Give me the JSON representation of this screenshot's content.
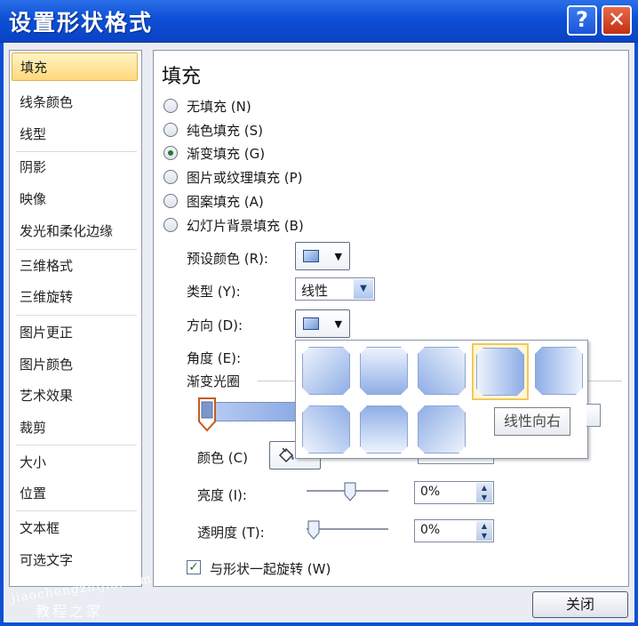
{
  "window": {
    "title": "设置形状格式",
    "help": "?",
    "close": "✕"
  },
  "sidebar": {
    "items": [
      {
        "label": "填充"
      },
      {
        "label": "线条颜色"
      },
      {
        "label": "线型"
      },
      {
        "label": "阴影"
      },
      {
        "label": "映像"
      },
      {
        "label": "发光和柔化边缘"
      },
      {
        "label": "三维格式"
      },
      {
        "label": "三维旋转"
      },
      {
        "label": "图片更正"
      },
      {
        "label": "图片颜色"
      },
      {
        "label": "艺术效果"
      },
      {
        "label": "裁剪"
      },
      {
        "label": "大小"
      },
      {
        "label": "位置"
      },
      {
        "label": "文本框"
      },
      {
        "label": "可选文字"
      }
    ],
    "selected": "填充"
  },
  "panel": {
    "title": "填充",
    "fill_options": [
      {
        "label": "无填充 (N)",
        "checked": false
      },
      {
        "label": "纯色填充 (S)",
        "checked": false
      },
      {
        "label": "渐变填充 (G)",
        "checked": true
      },
      {
        "label": "图片或纹理填充 (P)",
        "checked": false
      },
      {
        "label": "图案填充 (A)",
        "checked": false
      },
      {
        "label": "幻灯片背景填充 (B)",
        "checked": false
      }
    ],
    "preset_label": "预设颜色 (R):",
    "type_label": "类型 (Y):",
    "type_value": "线性",
    "direction_label": "方向 (D):",
    "angle_label": "角度 (E):",
    "stops_label": "渐变光圈",
    "color_label": "颜色 (C)",
    "brightness_label": "亮度 (I):",
    "brightness_value": "0%",
    "transparency_label": "透明度 (T):",
    "transparency_value": "0%",
    "rotate_label": "与形状一起旋转 (W)",
    "rotate_checked": true
  },
  "direction_popup": {
    "tiles": [
      {
        "name": "linear-diagonal-top-left"
      },
      {
        "name": "linear-down"
      },
      {
        "name": "linear-diagonal-top-right"
      },
      {
        "name": "linear-right"
      },
      {
        "name": "linear-left"
      },
      {
        "name": "linear-diagonal-bottom-left"
      },
      {
        "name": "linear-up"
      },
      {
        "name": "linear-diagonal-bottom-right"
      }
    ],
    "selected": "linear-right",
    "tooltip": "线性向右"
  },
  "footer": {
    "close_label": "关闭"
  },
  "watermark": {
    "line1": "jiaochengzhijia.com",
    "line2": "教程之家"
  },
  "colors": {
    "titlebar": "#0d4fd6",
    "tile_light": "#d2e0f8",
    "tile_dark": "#8faee6",
    "hover": "#f2c85b"
  }
}
